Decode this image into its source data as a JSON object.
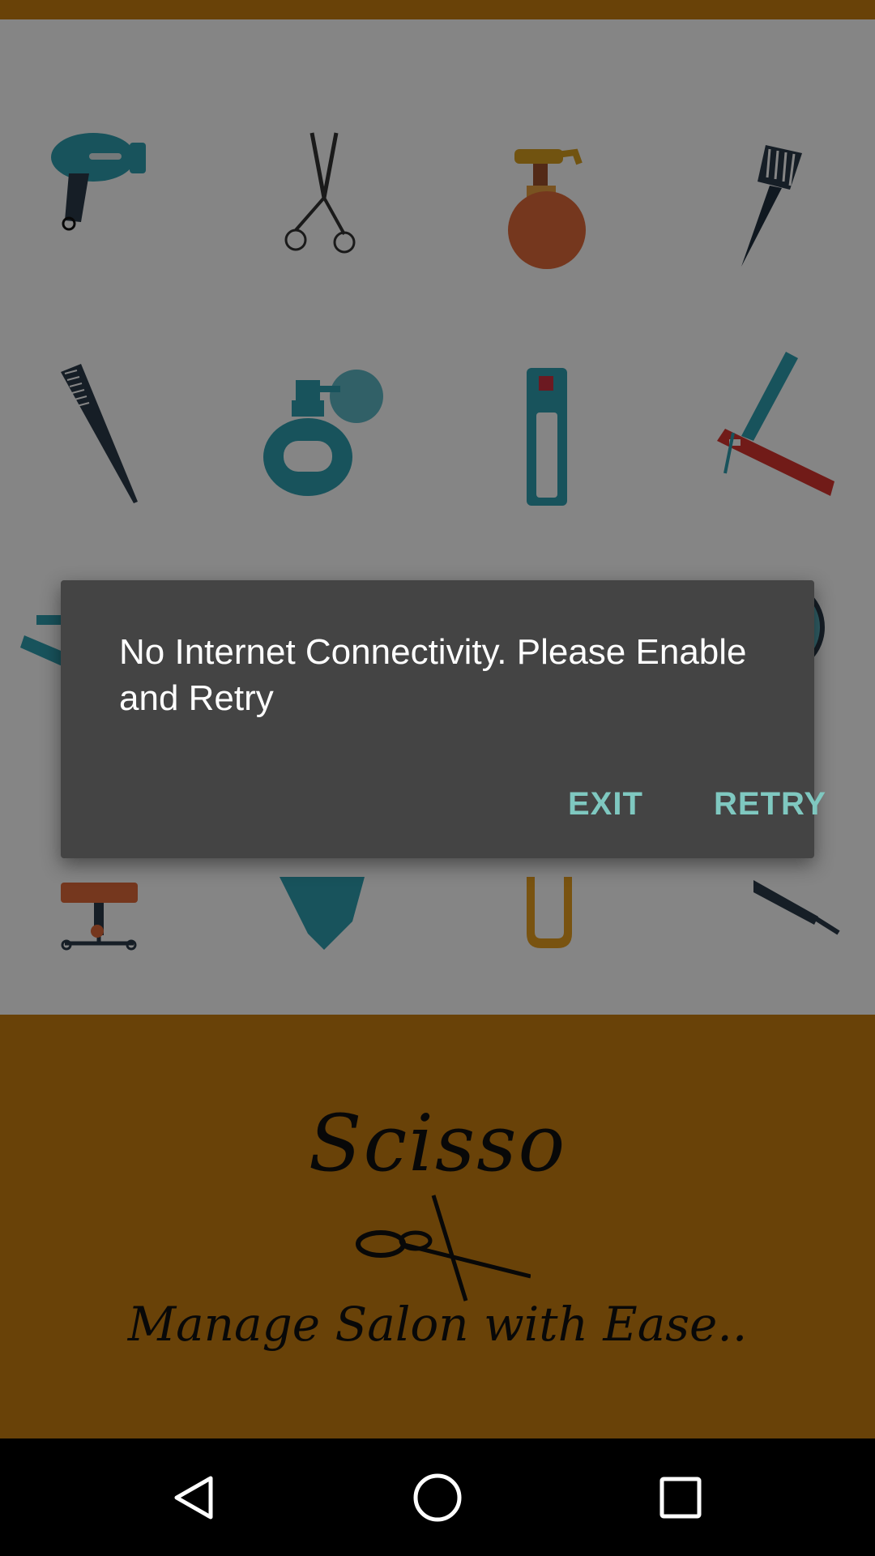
{
  "dialog": {
    "message": "No Internet Connectivity. Please Enable and Retry",
    "exit_label": "EXIT",
    "retry_label": "RETRY"
  },
  "brand": {
    "name": "Scisso",
    "tagline": "Manage Salon with Ease.."
  },
  "background_icons": [
    "hair-dryer-icon",
    "scissors-icon",
    "spray-bottle-icon",
    "dye-brush-icon",
    "comb-icon",
    "perfume-bottle-icon",
    "hair-spray-can-icon",
    "razor-icon",
    "clipper-icon",
    "mirror-icon",
    "barber-chair-icon",
    "cape-icon",
    "hair-clip-icon",
    "hair-iron-icon"
  ],
  "nav": {
    "back_icon": "back-triangle-icon",
    "home_icon": "home-circle-icon",
    "recents_icon": "recents-square-icon"
  },
  "colors": {
    "brand": "#ca7f10",
    "dialog_background": "#444444",
    "dialog_accent": "#7fc8c0"
  }
}
